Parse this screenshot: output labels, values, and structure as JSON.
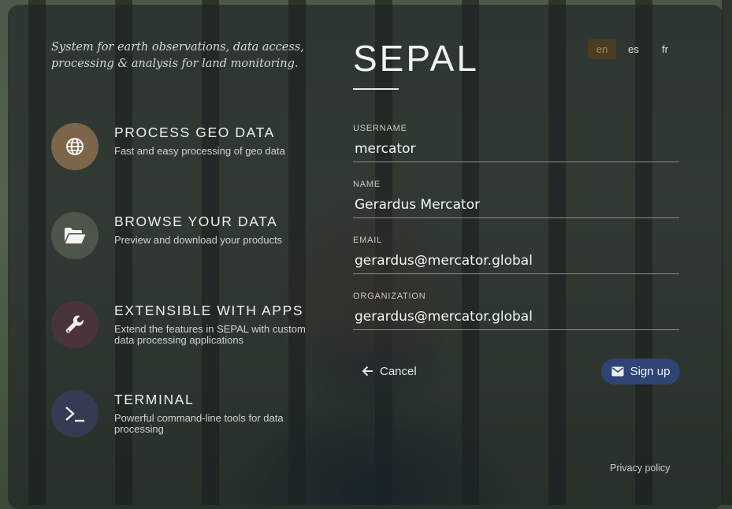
{
  "tagline": "System for earth observations, data access, processing & analysis for land monitoring.",
  "features": [
    {
      "title": "PROCESS GEO DATA",
      "description": "Fast and easy processing of geo data",
      "icon": "globe-icon",
      "color": "#7c6548"
    },
    {
      "title": "BROWSE YOUR DATA",
      "description": "Preview and download your products",
      "icon": "folder-open-icon",
      "color": "#4e564c"
    },
    {
      "title": "EXTENSIBLE WITH APPS",
      "description": "Extend the features in SEPAL with custom data processing applications",
      "icon": "wrench-icon",
      "color": "#493438"
    },
    {
      "title": "TERMINAL",
      "description": "Powerful command-line tools for data processing",
      "icon": "terminal-icon",
      "color": "#353b52"
    }
  ],
  "brand": "SEPAL",
  "languages": {
    "selected": "en",
    "options": [
      "en",
      "es",
      "fr"
    ]
  },
  "form": {
    "username": {
      "label": "USERNAME",
      "value": "mercator"
    },
    "name": {
      "label": "NAME",
      "value": "Gerardus Mercator"
    },
    "email": {
      "label": "EMAIL",
      "value": "gerardus@mercator.global"
    },
    "organization": {
      "label": "ORGANIZATION",
      "value": "gerardus@mercator.global"
    }
  },
  "actions": {
    "cancel_label": "Cancel",
    "signup_label": "Sign up"
  },
  "footer": {
    "privacy_label": "Privacy policy"
  },
  "colors": {
    "signup_button": "#2f4475",
    "active_language": "#4a3d24"
  }
}
